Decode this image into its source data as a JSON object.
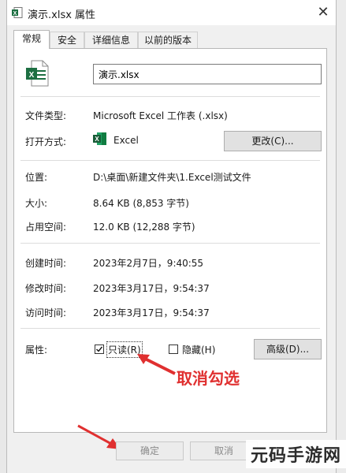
{
  "window": {
    "title": "演示.xlsx 属性",
    "close_glyph": "✕"
  },
  "tabs": [
    {
      "label": "常规",
      "active": true
    },
    {
      "label": "安全",
      "active": false
    },
    {
      "label": "详细信息",
      "active": false
    },
    {
      "label": "以前的版本",
      "active": false
    }
  ],
  "general": {
    "filename": "演示.xlsx",
    "file_type_label": "文件类型:",
    "file_type_value": "Microsoft Excel 工作表 (.xlsx)",
    "open_with_label": "打开方式:",
    "open_with_value": "Excel",
    "change_button": "更改(C)...",
    "location_label": "位置:",
    "location_value": "D:\\桌面\\新建文件夹\\1.Excel测试文件",
    "size_label": "大小:",
    "size_value": "8.64 KB (8,853 字节)",
    "disk_size_label": "占用空间:",
    "disk_size_value": "12.0 KB (12,288 字节)",
    "created_label": "创建时间:",
    "created_value": "2023年2月7日，9:40:55",
    "modified_label": "修改时间:",
    "modified_value": "2023年3月17日，9:54:37",
    "accessed_label": "访问时间:",
    "accessed_value": "2023年3月17日，9:54:37",
    "attributes_label": "属性:",
    "readonly_label": "只读(R)",
    "readonly_checked": true,
    "hidden_label": "隐藏(H)",
    "hidden_checked": false,
    "advanced_button": "高级(D)..."
  },
  "annotation": {
    "text": "取消勾选",
    "color": "#e03030"
  },
  "footer": {
    "ok_button": "确定",
    "cancel_button": "取消"
  },
  "watermark": "元码手游网",
  "colors": {
    "excel_green": "#1d6f42",
    "arrow_red": "#e03030"
  },
  "icons": [
    "excel-file-icon",
    "excel-app-icon",
    "close-icon",
    "checkmark-icon",
    "arrow-icon"
  ]
}
